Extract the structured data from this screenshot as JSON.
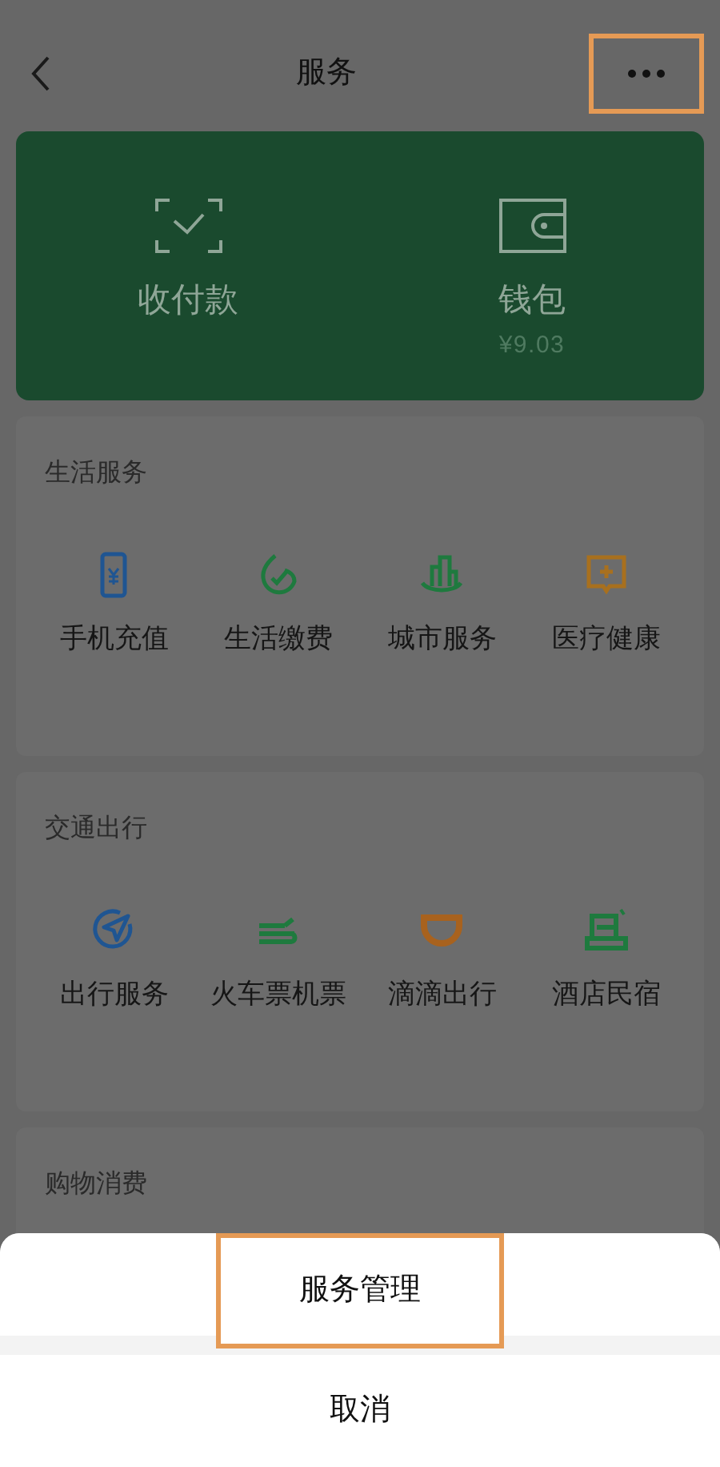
{
  "nav": {
    "title": "服务",
    "more_highlighted": true
  },
  "wallet_card": [
    {
      "kind": "scan",
      "label": "收付款"
    },
    {
      "kind": "wallet",
      "label": "钱包",
      "balance": "¥9.03"
    }
  ],
  "sections": [
    {
      "title": "生活服务",
      "items": [
        {
          "kind": "phone",
          "label": "手机充值",
          "color": "#1f5592"
        },
        {
          "kind": "leaf",
          "label": "生活缴费",
          "color": "#1e7a3e"
        },
        {
          "kind": "city",
          "label": "城市服务",
          "color": "#1e7a3e"
        },
        {
          "kind": "medical",
          "label": "医疗健康",
          "color": "#a8701e"
        }
      ]
    },
    {
      "title": "交通出行",
      "items": [
        {
          "kind": "compass",
          "label": "出行服务",
          "color": "#1f5592"
        },
        {
          "kind": "train",
          "label": "火车票机票",
          "color": "#1e7a3e"
        },
        {
          "kind": "cup",
          "label": "滴滴出行",
          "color": "#a8621e"
        },
        {
          "kind": "bed",
          "label": "酒店民宿",
          "color": "#1e7a3e"
        }
      ]
    },
    {
      "title": "购物消费"
    }
  ],
  "action_sheet": {
    "items": [
      {
        "label": "服务管理",
        "highlighted": true
      }
    ],
    "cancel": "取消"
  }
}
